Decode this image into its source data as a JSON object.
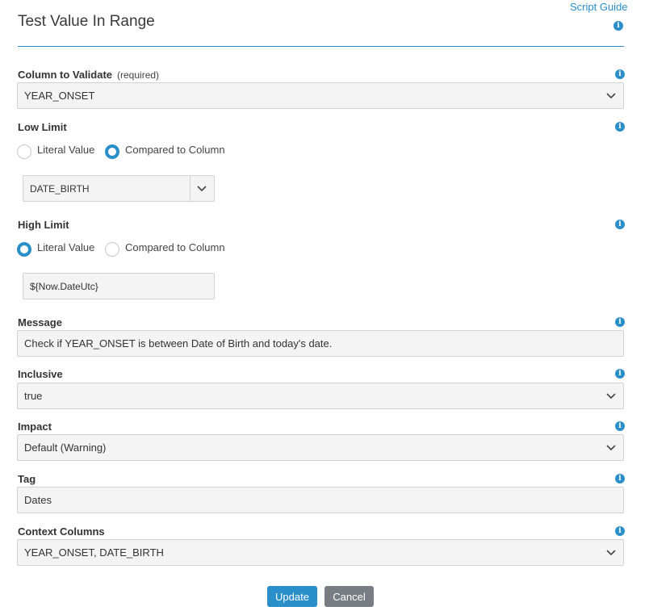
{
  "header": {
    "title": "Test Value In Range",
    "script_guide": "Script Guide"
  },
  "icons": {
    "info": "info-icon",
    "dropdown": "chevron-down-icon"
  },
  "colors": {
    "accent": "#2a8fc9",
    "cancel": "#777d83",
    "field_bg": "#f4f4f4"
  },
  "column_to_validate": {
    "label": "Column to Validate",
    "required": "(required)",
    "value": "YEAR_ONSET"
  },
  "low_limit": {
    "label": "Low Limit",
    "option_literal": "Literal Value",
    "option_column": "Compared to Column",
    "selected": "Compared to Column",
    "value": "DATE_BIRTH"
  },
  "high_limit": {
    "label": "High Limit",
    "option_literal": "Literal Value",
    "option_column": "Compared to Column",
    "selected": "Literal Value",
    "value": "${Now.DateUtc}"
  },
  "message": {
    "label": "Message",
    "value": "Check if YEAR_ONSET is between Date of Birth and today's date."
  },
  "inclusive": {
    "label": "Inclusive",
    "value": "true"
  },
  "impact": {
    "label": "Impact",
    "value": "Default (Warning)"
  },
  "tag": {
    "label": "Tag",
    "value": "Dates"
  },
  "context_columns": {
    "label": "Context Columns",
    "value": "YEAR_ONSET, DATE_BIRTH"
  },
  "actions": {
    "update": "Update",
    "cancel": "Cancel"
  }
}
